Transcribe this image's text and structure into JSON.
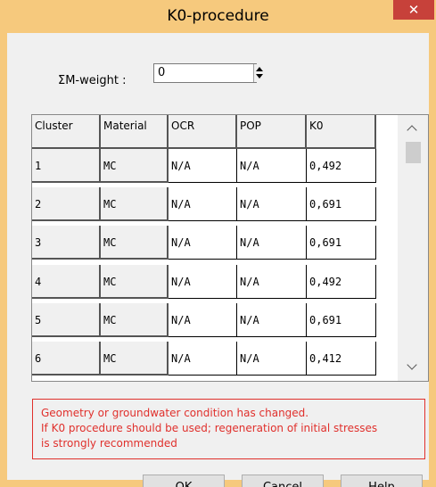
{
  "window": {
    "title": "K0-procedure",
    "close_glyph": "✕"
  },
  "weight": {
    "label": "ΣM-weight :",
    "value": "0"
  },
  "grid": {
    "columns": [
      "Cluster",
      "Material",
      "OCR",
      "POP",
      "K0"
    ],
    "rows": [
      [
        "1",
        "MC",
        "N/A",
        "N/A",
        "0,492"
      ],
      [
        "2",
        "MC",
        "N/A",
        "N/A",
        "0,691"
      ],
      [
        "3",
        "MC",
        "N/A",
        "N/A",
        "0,691"
      ],
      [
        "4",
        "MC",
        "N/A",
        "N/A",
        "0,492"
      ],
      [
        "5",
        "MC",
        "N/A",
        "N/A",
        "0,691"
      ],
      [
        "6",
        "MC",
        "N/A",
        "N/A",
        "0,412"
      ]
    ]
  },
  "warning": {
    "line1": "Geometry or groundwater condition has changed.",
    "line2": "If K0 procedure should be used; regeneration of initial stresses",
    "line3": "is strongly recommended"
  },
  "buttons": {
    "ok": "OK",
    "cancel": "Cancel",
    "help": "Help"
  },
  "colors": {
    "title_bar": "#f6c97d",
    "close": "#c7413a",
    "warning": "#e0302c"
  }
}
